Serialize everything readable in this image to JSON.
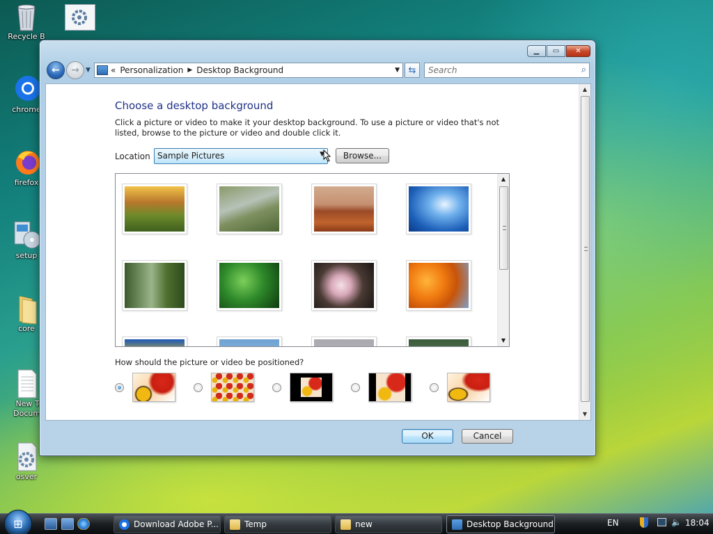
{
  "desktop": {
    "icons": [
      {
        "label": "Recycle B"
      },
      {
        "label": "chrome"
      },
      {
        "label": "firefox"
      },
      {
        "label": "setup"
      },
      {
        "label": "core"
      },
      {
        "label": "New Te Docume"
      },
      {
        "label": "osver"
      }
    ]
  },
  "window": {
    "breadcrumb": [
      "Personalization",
      "Desktop Background"
    ],
    "search_placeholder": "Search",
    "title": "Choose a desktop background",
    "description": "Click a picture or video to make it your desktop background. To use a picture or video that's not listed, browse to the picture or video and double click it.",
    "location_label": "Location",
    "location_value": "Sample Pictures",
    "browse_label": "Browse...",
    "position_question": "How should the picture or video be positioned?",
    "position_selected": 0,
    "ok_label": "OK",
    "cancel_label": "Cancel"
  },
  "taskbar": {
    "buttons": [
      {
        "label": "Download Adobe P..."
      },
      {
        "label": "Temp"
      },
      {
        "label": "new"
      },
      {
        "label": "Desktop Background"
      }
    ],
    "language": "EN",
    "clock": "18:04"
  },
  "colors": {
    "title_blue": "#1e3287",
    "accent": "#3c7fb1"
  }
}
